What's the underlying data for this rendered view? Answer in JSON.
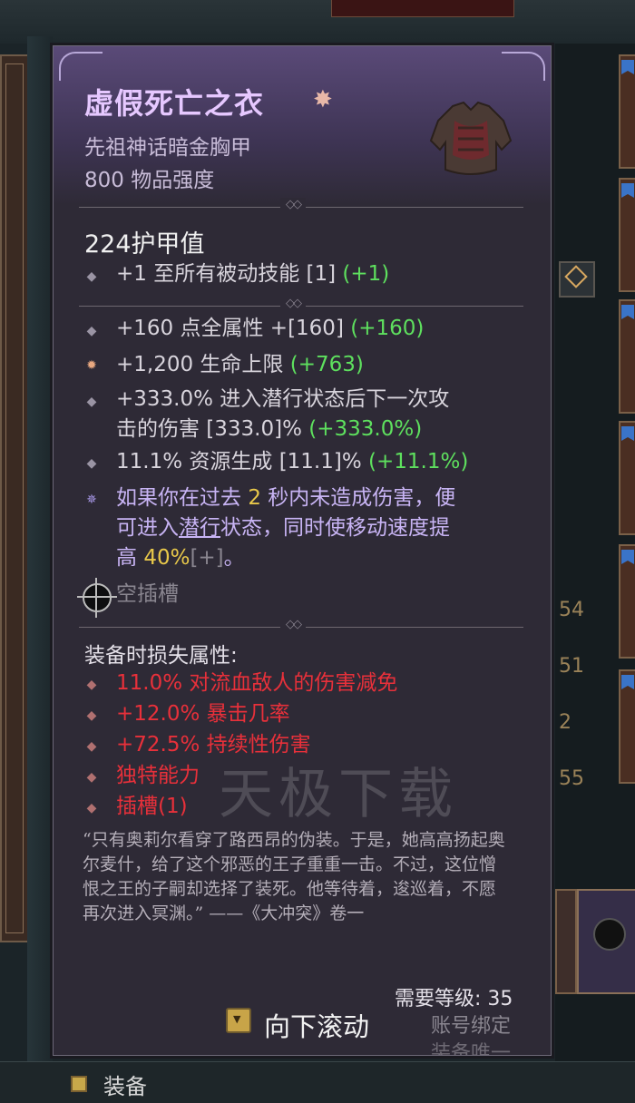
{
  "item": {
    "name": "虚假死亡之衣",
    "type": "先祖神话暗金胸甲",
    "power": "800 物品强度",
    "armor": "224护甲值"
  },
  "implicit": [
    {
      "parts": [
        {
          "t": "+1 至所有被动技能 [1] ",
          "c": ""
        },
        {
          "t": "(+1)",
          "c": "green"
        }
      ]
    }
  ],
  "affixes": [
    {
      "bullet": "◆",
      "parts": [
        {
          "t": "+160 点全属性 +[160] ",
          "c": ""
        },
        {
          "t": "(+160)",
          "c": "green"
        }
      ]
    },
    {
      "bullet": "✹",
      "parts": [
        {
          "t": "+1,200 生命上限 ",
          "c": ""
        },
        {
          "t": "(+763)",
          "c": "green"
        }
      ]
    },
    {
      "bullet": "◆",
      "line2": true,
      "parts": [
        {
          "t": "+333.0% 进入潜行状态后下一次攻",
          "c": ""
        }
      ]
    },
    {
      "bullet": "",
      "parts": [
        {
          "t": "击的伤害 [333.0]% ",
          "c": ""
        },
        {
          "t": "(+333.0%)",
          "c": "green"
        }
      ]
    },
    {
      "bullet": "◆",
      "parts": [
        {
          "t": "11.1% 资源生成 [11.1]% ",
          "c": ""
        },
        {
          "t": "(+11.1%)",
          "c": "green"
        }
      ]
    }
  ],
  "unique": [
    {
      "parts": [
        {
          "t": "如果你在过去 ",
          "c": "lav"
        },
        {
          "t": "2",
          "c": "yellow"
        },
        {
          "t": " 秒内未造成伤害，便",
          "c": "lav"
        }
      ]
    },
    {
      "parts": [
        {
          "t": "可进入",
          "c": "lav"
        },
        {
          "t": "潜行",
          "c": "lav ul"
        },
        {
          "t": "状态，同时使移动速度提",
          "c": "lav"
        }
      ]
    },
    {
      "parts": [
        {
          "t": "高 ",
          "c": "lav"
        },
        {
          "t": "40%",
          "c": "yellow"
        },
        {
          "t": "[+]",
          "c": "grey"
        },
        {
          "t": "。",
          "c": "lav"
        }
      ]
    }
  ],
  "socket_label": "空插槽",
  "lost": {
    "header": "装备时损失属性:",
    "items": [
      "11.0% 对流血敌人的伤害减免",
      "+12.0% 暴击几率",
      "+72.5% 持续性伤害",
      "独特能力",
      "插槽(1)"
    ]
  },
  "flavor": "“只有奥莉尔看穿了路西昂的伪装。于是，她高高扬起奥尔麦什，给了这个邪恶的王子重重一击。不过，这位憎恨之王的子嗣却选择了装死。他等待着，逡巡着，不愿再次进入冥渊。” ——《大冲突》卷一",
  "footer": {
    "required_level": "需要等级: 35",
    "account_bound": "账号绑定",
    "unique_equipped": "装备唯一"
  },
  "scroll_label": "向下滚动",
  "bottom_bar": {
    "label": "装备"
  },
  "watermark": "天极下载",
  "background_numbers": [
    "54",
    "51",
    "2",
    "55"
  ],
  "colors": {
    "name": "#e6c8ff",
    "bonus": "#5ee05e",
    "unique": "#c8b4f4",
    "lost": "#e8303a",
    "highlight": "#e8c84a"
  }
}
